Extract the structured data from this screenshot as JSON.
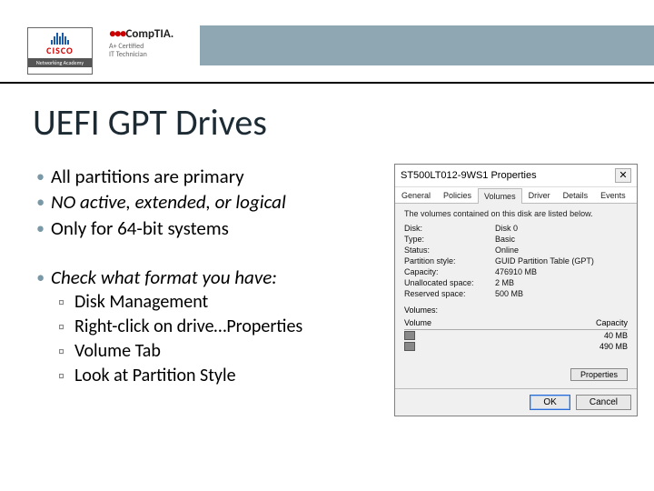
{
  "logos": {
    "cisco": {
      "name": "CISCO",
      "sub": "Networking Academy"
    },
    "comptia": {
      "brand_prefix": "●●● ",
      "brand": "CompTIA",
      "cert_line1": "A+ Certified",
      "cert_line2": "IT Technician"
    }
  },
  "title": "UEFI GPT Drives",
  "bullets_top": [
    {
      "text": "All partitions are primary",
      "italic": false
    },
    {
      "text": "NO active, extended, or logical",
      "italic": true
    },
    {
      "text": "Only for 64-bit systems",
      "italic": false
    }
  ],
  "bullets_check": {
    "lead": "Check what format you have:",
    "subs": [
      "Disk Management",
      "Right-click on drive…Properties",
      "Volume Tab",
      "Look at Partition Style"
    ]
  },
  "dialog": {
    "title": "ST500LT012-9WS1 Properties",
    "close": "✕",
    "tabs": [
      "General",
      "Policies",
      "Volumes",
      "Driver",
      "Details",
      "Events"
    ],
    "active_tab": "Volumes",
    "desc": "The volumes contained on this disk are listed below.",
    "rows": [
      {
        "k": "Disk:",
        "v": "Disk 0"
      },
      {
        "k": "Type:",
        "v": "Basic"
      },
      {
        "k": "Status:",
        "v": "Online"
      },
      {
        "k": "Partition style:",
        "v": "GUID Partition Table (GPT)"
      },
      {
        "k": "Capacity:",
        "v": "476910 MB"
      },
      {
        "k": "Unallocated space:",
        "v": "2 MB"
      },
      {
        "k": "Reserved space:",
        "v": "500 MB"
      }
    ],
    "volumes_label": "Volumes:",
    "vol_cols": {
      "a": "Volume",
      "b": "Capacity"
    },
    "vol_rows": [
      {
        "name": "",
        "cap": "40 MB"
      },
      {
        "name": "",
        "cap": "490 MB"
      }
    ],
    "properties_btn": "Properties",
    "ok": "OK",
    "cancel": "Cancel"
  }
}
